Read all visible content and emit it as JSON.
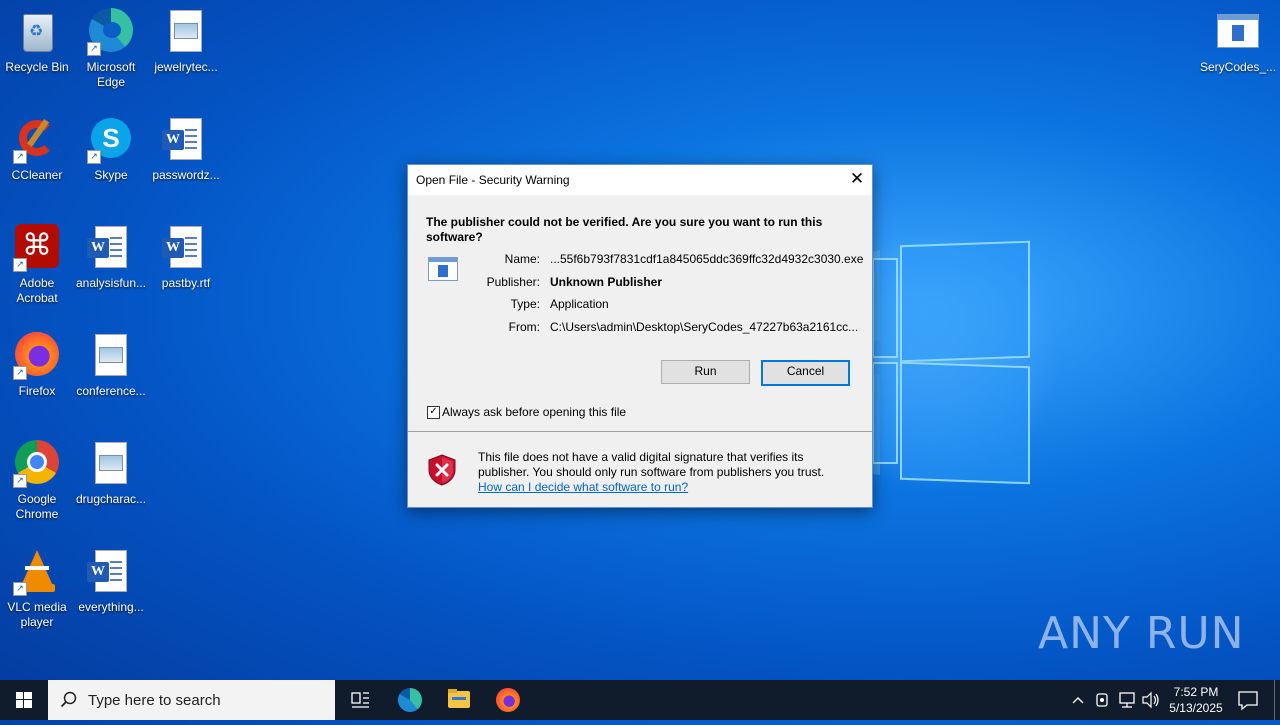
{
  "desktop_icons": [
    {
      "label": "Recycle Bin",
      "icon": "recycle-bin-icon"
    },
    {
      "label": "Microsoft Edge",
      "icon": "edge-icon"
    },
    {
      "label": "jewelrytec...",
      "icon": "image-file-icon"
    },
    {
      "label": "CCleaner",
      "icon": "ccleaner-icon"
    },
    {
      "label": "Skype",
      "icon": "skype-icon"
    },
    {
      "label": "passwordz...",
      "icon": "word-doc-icon"
    },
    {
      "label": "Adobe Acrobat",
      "icon": "acrobat-icon"
    },
    {
      "label": "analysisfun...",
      "icon": "word-doc-icon"
    },
    {
      "label": "pastby.rtf",
      "icon": "word-doc-icon"
    },
    {
      "label": "Firefox",
      "icon": "firefox-icon"
    },
    {
      "label": "conference...",
      "icon": "image-file-icon"
    },
    {
      "label": "Google Chrome",
      "icon": "chrome-icon"
    },
    {
      "label": "drugcharac...",
      "icon": "image-file-icon"
    },
    {
      "label": "VLC media player",
      "icon": "vlc-icon"
    },
    {
      "label": "everything...",
      "icon": "word-doc-icon"
    },
    {
      "label": "SeryCodes_...",
      "icon": "app-exe-icon"
    }
  ],
  "dialog": {
    "title": "Open File - Security Warning",
    "question": "The publisher could not be verified.  Are you sure you want to run this software?",
    "name_label": "Name:",
    "name_value": "...55f6b793f7831cdf1a845065ddc369ffc32d4932c3030.exe",
    "publisher_label": "Publisher:",
    "publisher_value": "Unknown Publisher",
    "type_label": "Type:",
    "type_value": "Application",
    "from_label": "From:",
    "from_value": "C:\\Users\\admin\\Desktop\\SeryCodes_47227b63a2161cc...",
    "run_button": "Run",
    "cancel_button": "Cancel",
    "checkbox_label": "Always ask before opening this file",
    "checkbox_checked": true,
    "warning_text": "This file does not have a valid digital signature that verifies its publisher.  You should only run software from publishers you trust.",
    "help_link": "How can I decide what software to run?"
  },
  "taskbar": {
    "search_placeholder": "Type here to search",
    "pinned": [
      "task-view-icon",
      "edge-icon",
      "file-explorer-icon",
      "firefox-icon"
    ],
    "time": "7:52 PM",
    "date": "5/13/2025"
  },
  "watermark": "ANY RUN"
}
